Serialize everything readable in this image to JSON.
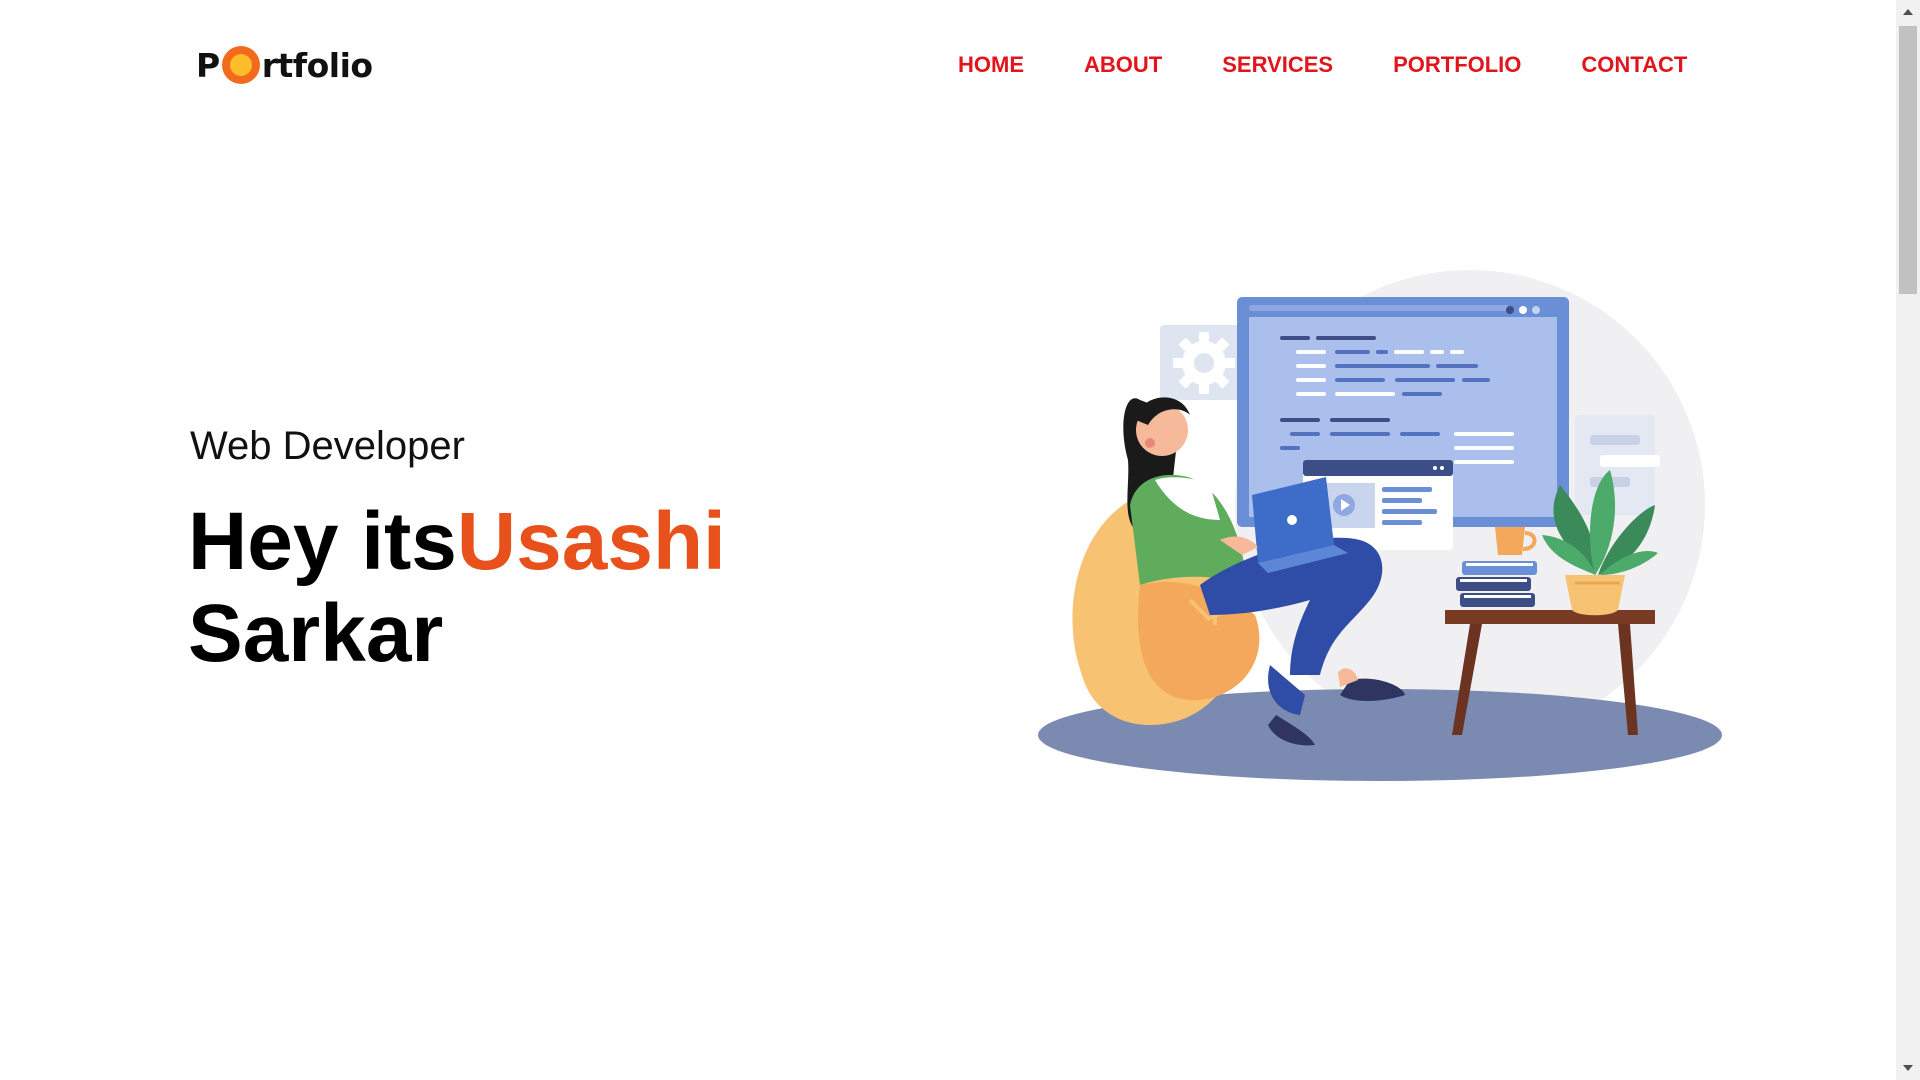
{
  "header": {
    "logo": {
      "prefix": "P",
      "suffix": "rtfolio"
    },
    "nav": [
      {
        "label": "HOME"
      },
      {
        "label": "ABOUT"
      },
      {
        "label": "SERVICES"
      },
      {
        "label": "PORTFOLIO"
      },
      {
        "label": "CONTACT"
      }
    ]
  },
  "hero": {
    "subtitle": "Web Developer",
    "greeting": "Hey its",
    "first_name": "Usashi",
    "last_name": "Sarkar"
  },
  "colors": {
    "nav": "#e0161c",
    "accent": "#e8501c",
    "logo_ring": "#f26a1b",
    "logo_dot": "#fbbd2a"
  },
  "icons": {
    "scroll_up": "triangle-up-icon",
    "scroll_down": "triangle-down-icon"
  }
}
